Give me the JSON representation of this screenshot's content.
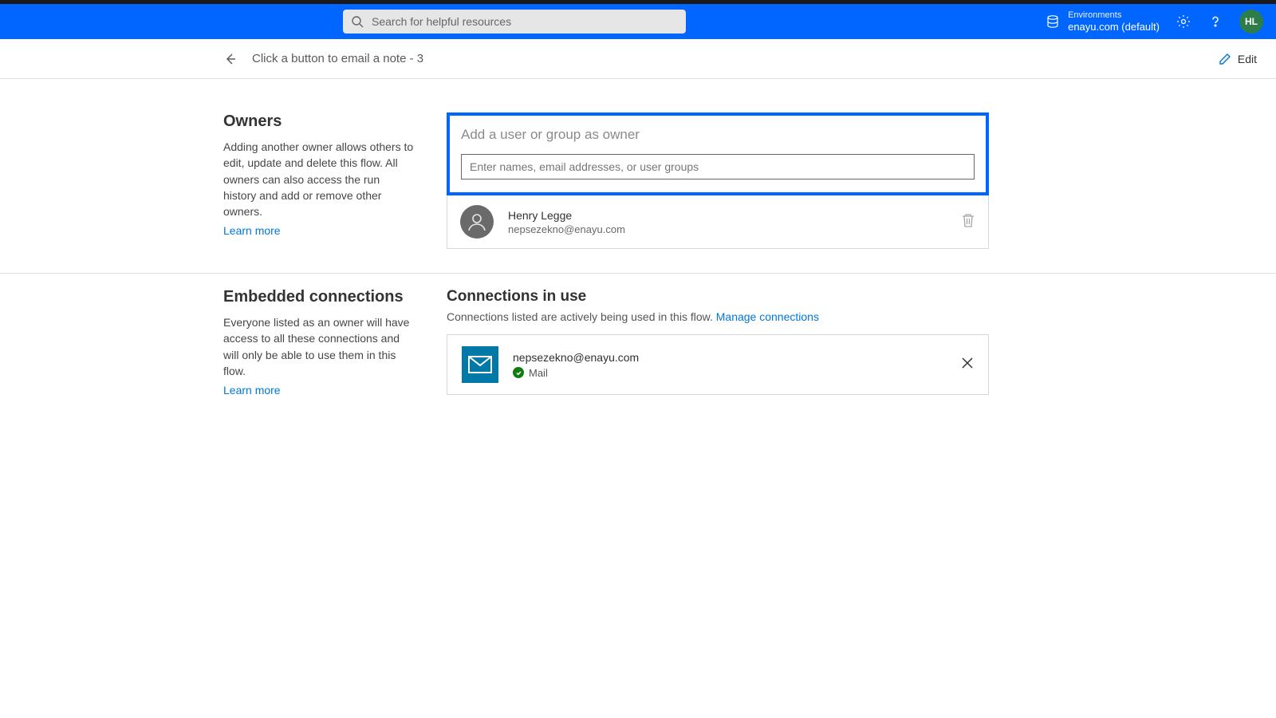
{
  "header": {
    "search_placeholder": "Search for helpful resources",
    "env_label": "Environments",
    "env_name": "enayu.com (default)",
    "avatar_initials": "HL"
  },
  "subheader": {
    "flow_title": "Click a button to email a note - 3",
    "edit_label": "Edit"
  },
  "owners": {
    "heading": "Owners",
    "description": "Adding another owner allows others to edit, update and delete this flow. All owners can also access the run history and add or remove other owners.",
    "learn_more": "Learn more",
    "add_box_title": "Add a user or group as owner",
    "input_placeholder": "Enter names, email addresses, or user groups",
    "list": [
      {
        "name": "Henry Legge",
        "email": "nepsezekno@enayu.com"
      }
    ]
  },
  "connections": {
    "left_heading": "Embedded connections",
    "left_description": "Everyone listed as an owner will have access to all these connections and will only be able to use them in this flow.",
    "learn_more": "Learn more",
    "right_heading": "Connections in use",
    "right_sub": "Connections listed are actively being used in this flow. ",
    "manage_link": "Manage connections",
    "items": [
      {
        "email": "nepsezekno@enayu.com",
        "service": "Mail"
      }
    ]
  }
}
